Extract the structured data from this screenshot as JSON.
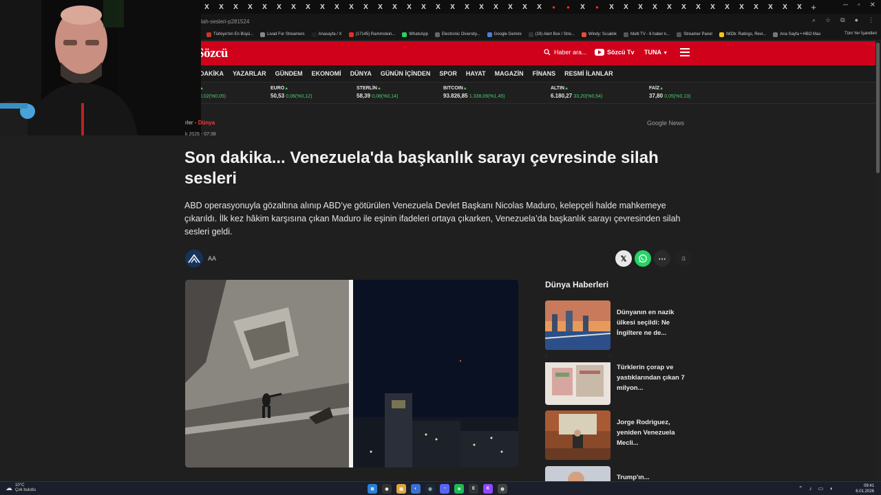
{
  "browser": {
    "tabs": [
      "X",
      "X",
      "X",
      "X",
      "X",
      "X",
      "X",
      "X",
      "X",
      "X",
      "X",
      "X",
      "X",
      "X",
      "X",
      "X",
      "X",
      "X",
      "X",
      "X",
      "X",
      "X",
      "X",
      "X",
      "X",
      "X",
      "X",
      "X",
      "X",
      "X",
      "X",
      "X",
      "X",
      "X",
      "X",
      "X",
      "X",
      "X",
      "X",
      "X",
      "X",
      "X"
    ],
    "url": "lah-sesleri-p281524",
    "bookmarks": [
      "Türkiye'nin En Büyü...",
      "Livad For Streamers",
      "Anasayfa / X",
      "(17145) Rammstein...",
      "WhatsApp",
      "Electronic Diversity...",
      "Google Gemini",
      "(19) Alert Box / Stre...",
      "Windy: Sıcaklık",
      "Multi TV - 6 haber k...",
      "Streamer Panel",
      "IMDb: Ratings, Revi...",
      "Ana Sayfa • HBO Max"
    ],
    "bookmarks_right": "Tüm Yer İşaretleri"
  },
  "site": {
    "logo": "Sözcü",
    "search_label": "Haber ara...",
    "tv_label": "Sözcü Tv",
    "user_label": "TUNA",
    "nav": [
      "DAKİKA",
      "YAZARLAR",
      "GÜNDEM",
      "EKONOMİ",
      "DÜNYA",
      "GÜNÜN İÇİNDEN",
      "SPOR",
      "HAYAT",
      "MAGAZİN",
      "FİNANS",
      "RESMİ İLANLAR"
    ],
    "ticker": [
      {
        "name": "",
        "value": "",
        "change": "0,02(%0,05)"
      },
      {
        "name": "EURO",
        "value": "50,53",
        "change": "0,06(%0,12)"
      },
      {
        "name": "STERLİN",
        "value": "58,39",
        "change": "0,08(%0,14)"
      },
      {
        "name": "BITCOIN",
        "value": "93.826,85",
        "change": "1.338,09(%1,45)"
      },
      {
        "name": "ALTIN",
        "value": "6.180,27",
        "change": "33,20(%0,54)"
      },
      {
        "name": "FAİZ",
        "value": "37,80",
        "change": "0,05(%0,13)"
      }
    ]
  },
  "article": {
    "breadcrumb_prefix": "rler -",
    "breadcrumb_category": "Dünya",
    "date": "k 2026 - 07:38",
    "google_news": "Google News",
    "headline": "Son dakika... Venezuela'da başkanlık sarayı çevresinde silah sesleri",
    "summary": "ABD operasyonuyla gözaltına alınıp ABD’ye götürülen Venezuela Devlet Başkanı Nicolas Maduro, kelepçeli halde mahkemeye çıkarıldı. İlk kez hâkim karşısına çıkan Maduro ile eşinin ifadeleri ortaya çıkarken, Venezuela’da başkanlık sarayı çevresinden silah sesleri geldi.",
    "source": "AA",
    "share_more": "a"
  },
  "sidebar": {
    "title": "Dünya Haberleri",
    "items": [
      {
        "text": "Dünyanın en nazik ülkesi seçildi: Ne İngiltere ne de..."
      },
      {
        "text": "Türklerin çorap ve yastıklarından çıkan 7 milyon..."
      },
      {
        "text": "Jorge Rodriguez, yeniden Venezuela Mecli..."
      },
      {
        "text": "Trump'ın..."
      }
    ]
  },
  "taskbar": {
    "temp": "10°C",
    "weather": "Çok bulutlu",
    "time": "09:41",
    "date": "6.01.2026"
  }
}
